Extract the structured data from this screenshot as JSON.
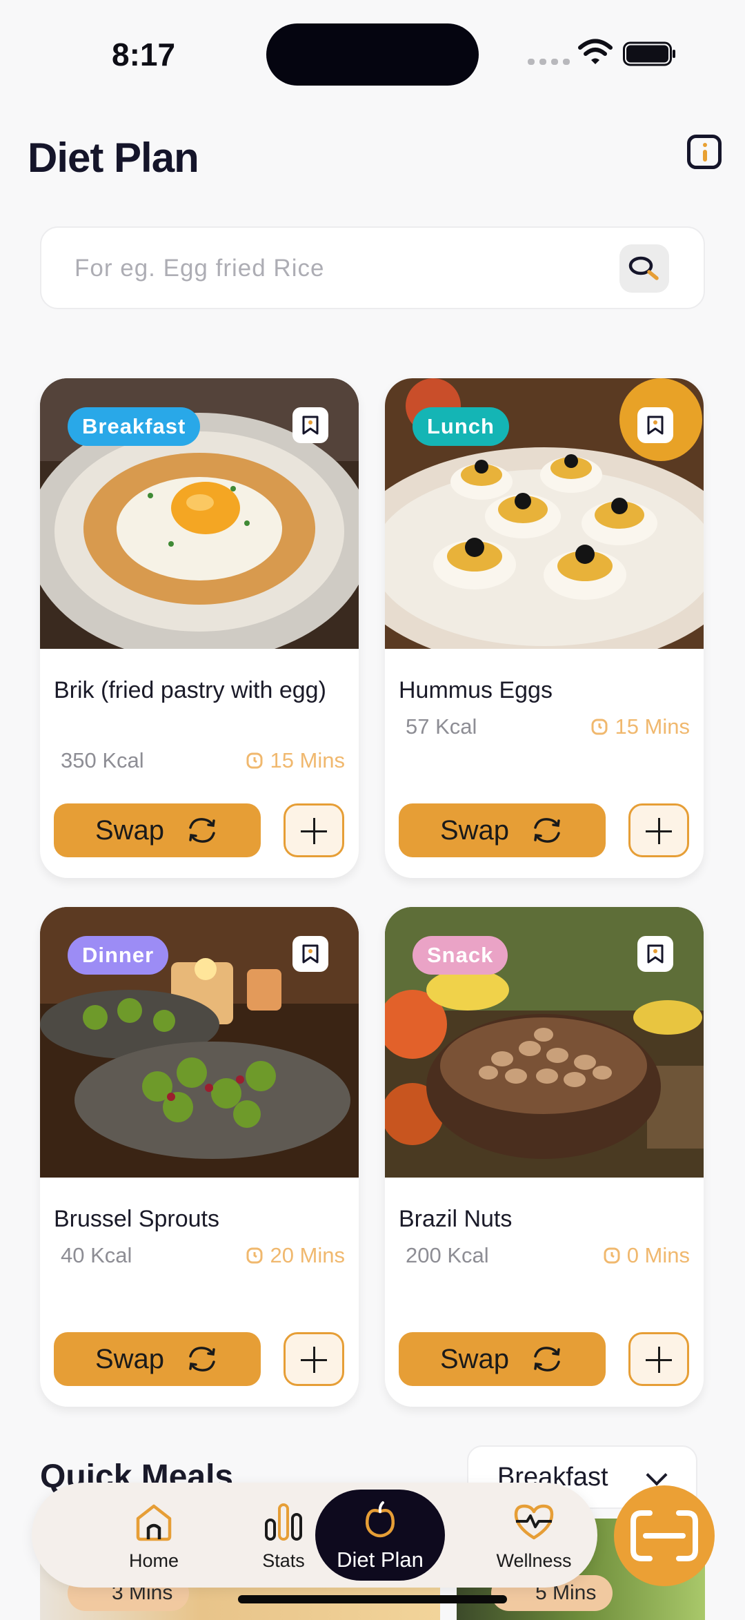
{
  "status": {
    "time": "8:17"
  },
  "header": {
    "title": "Diet Plan"
  },
  "search": {
    "placeholder": "For eg. Egg fried Rice",
    "value": ""
  },
  "meals": [
    {
      "tag": "Breakfast",
      "tag_color": "#29A8E8",
      "name": "Brik (fried pastry with egg)",
      "kcal": "350 Kcal",
      "mins": "15 Mins",
      "swap_label": "Swap"
    },
    {
      "tag": "Lunch",
      "tag_color": "#14B5B5",
      "name": "Hummus Eggs",
      "kcal": "57 Kcal",
      "mins": "15 Mins",
      "swap_label": "Swap"
    },
    {
      "tag": "Dinner",
      "tag_color": "#9C8CF5",
      "name": "Brussel Sprouts",
      "kcal": "40 Kcal",
      "mins": "20 Mins",
      "swap_label": "Swap"
    },
    {
      "tag": "Snack",
      "tag_color": "#EAA3C6",
      "name": "Brazil Nuts",
      "kcal": "200 Kcal",
      "mins": "0 Mins",
      "swap_label": "Swap"
    }
  ],
  "quick_meals": {
    "title": "Quick Meals",
    "filter": "Breakfast",
    "items": [
      {
        "mins": "3 Mins"
      },
      {
        "mins": "5 Mins"
      }
    ]
  },
  "nav": {
    "items": [
      {
        "label": "Home",
        "icon": "home-icon"
      },
      {
        "label": "Stats",
        "icon": "stats-icon"
      },
      {
        "label": "Diet Plan",
        "icon": "apple-icon"
      },
      {
        "label": "Wellness",
        "icon": "heart-pulse-icon"
      }
    ],
    "active": "Diet Plan"
  },
  "colors": {
    "accent": "#E69E36",
    "dark": "#0E0A1E",
    "background": "#F8F8F9"
  }
}
